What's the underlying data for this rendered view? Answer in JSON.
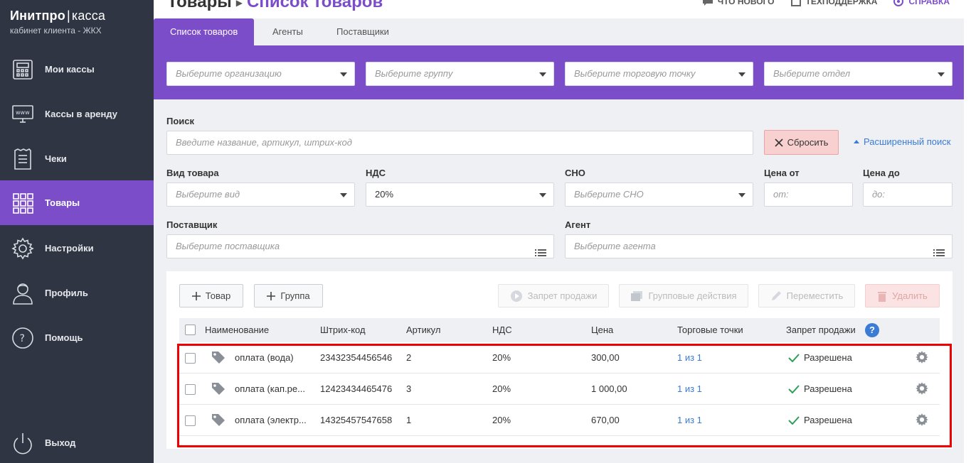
{
  "brand": {
    "title_main": "Инитпро",
    "title_sep": "|",
    "title_sub": "касса",
    "subtitle": "кабинет клиента - ЖКХ"
  },
  "sidebar": {
    "items": [
      {
        "label": "Мои кассы",
        "icon": "cash-register-icon"
      },
      {
        "label": "Кассы в аренду",
        "icon": "www-monitor-icon"
      },
      {
        "label": "Чеки",
        "icon": "receipt-icon"
      },
      {
        "label": "Товары",
        "icon": "grid-icon",
        "active": true
      },
      {
        "label": "Настройки",
        "icon": "gear-icon"
      },
      {
        "label": "Профиль",
        "icon": "user-icon"
      },
      {
        "label": "Помощь",
        "icon": "question-icon"
      }
    ],
    "logout": "Выход"
  },
  "header": {
    "crumb_root": "Товары",
    "crumb_current": "Список товаров",
    "links": [
      "ЧТО НОВОГО",
      "ТЕХПОДДЕРЖКА",
      "СПРАВКА"
    ]
  },
  "tabs": [
    "Список товаров",
    "Агенты",
    "Поставщики"
  ],
  "band_filters": [
    "Выберите организацию",
    "Выберите группу",
    "Выберите торговую точку",
    "Выберите отдел"
  ],
  "search": {
    "label": "Поиск",
    "placeholder": "Введите название, артикул, штрих-код",
    "reset": "Сбросить",
    "advanced": "Расширенный поиск"
  },
  "filters": {
    "kind_label": "Вид товара",
    "kind_placeholder": "Выберите вид",
    "vat_label": "НДС",
    "vat_value": "20%",
    "sno_label": "СНО",
    "sno_placeholder": "Выберите СНО",
    "price_from_label": "Цена от",
    "price_from_placeholder": "от:",
    "price_to_label": "Цена до",
    "price_to_placeholder": "до:",
    "supplier_label": "Поставщик",
    "supplier_placeholder": "Выберите поставщика",
    "agent_label": "Агент",
    "agent_placeholder": "Выберите агента"
  },
  "toolbar": {
    "add_product": "Товар",
    "add_group": "Группа",
    "ban_sale": "Запрет продажи",
    "group_actions": "Групповые действия",
    "move": "Переместить",
    "delete": "Удалить"
  },
  "table": {
    "columns": [
      "Наименование",
      "Штрих-код",
      "Артикул",
      "НДС",
      "Цена",
      "Торговые точки",
      "Запрет продажи"
    ],
    "help": "?",
    "rows": [
      {
        "name": "оплата (вода)",
        "barcode": "23432354456546",
        "article": "2",
        "vat": "20%",
        "price": "300,00",
        "points": "1 из 1",
        "status": "Разрешена"
      },
      {
        "name": "оплата (кап.ре...",
        "barcode": "12423434465476",
        "article": "3",
        "vat": "20%",
        "price": "1 000,00",
        "points": "1 из 1",
        "status": "Разрешена"
      },
      {
        "name": "оплата (электр...",
        "barcode": "14325457547658",
        "article": "1",
        "vat": "20%",
        "price": "670,00",
        "points": "1 из 1",
        "status": "Разрешена"
      }
    ]
  },
  "colors": {
    "accent": "#7b4dc9",
    "sidebar": "#2f3542",
    "link": "#3a7bd5",
    "ok": "#2e9e5b",
    "highlight": "#ee0000"
  }
}
